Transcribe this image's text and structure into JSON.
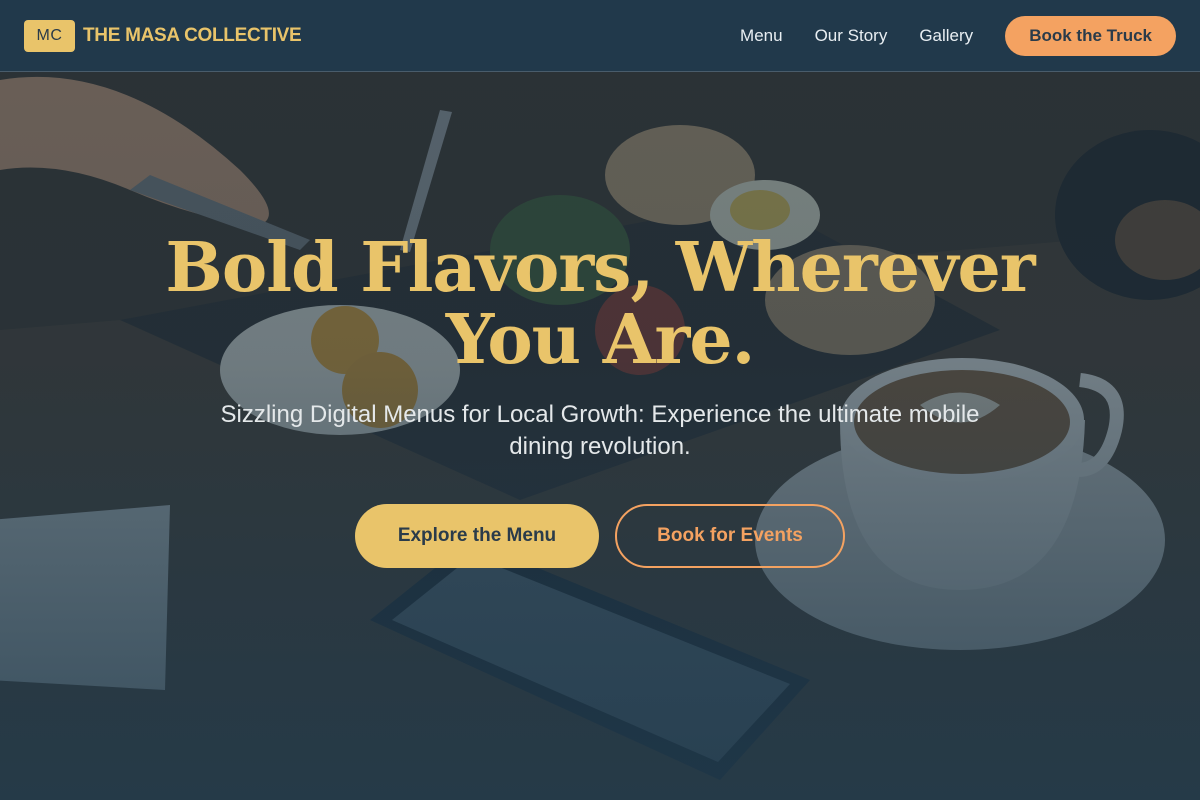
{
  "brand": {
    "badge": "MC",
    "name": "THE MASA COLLECTIVE"
  },
  "nav": {
    "items": [
      {
        "label": "Menu"
      },
      {
        "label": "Our Story"
      },
      {
        "label": "Gallery"
      }
    ],
    "cta_label": "Book the Truck"
  },
  "hero": {
    "headline": "Bold Flavors, Wherever You Are.",
    "subheadline": "Sizzling Digital Menus for Local Growth: Experience the ultimate mobile dining revolution.",
    "primary_button": "Explore the Menu",
    "secondary_button": "Book for Events",
    "background_image": "food-table-photo"
  },
  "colors": {
    "header_bg": "#213a4d",
    "accent_gold": "#e9c46a",
    "accent_orange": "#f4a261",
    "text_light": "#e4e8ea"
  }
}
